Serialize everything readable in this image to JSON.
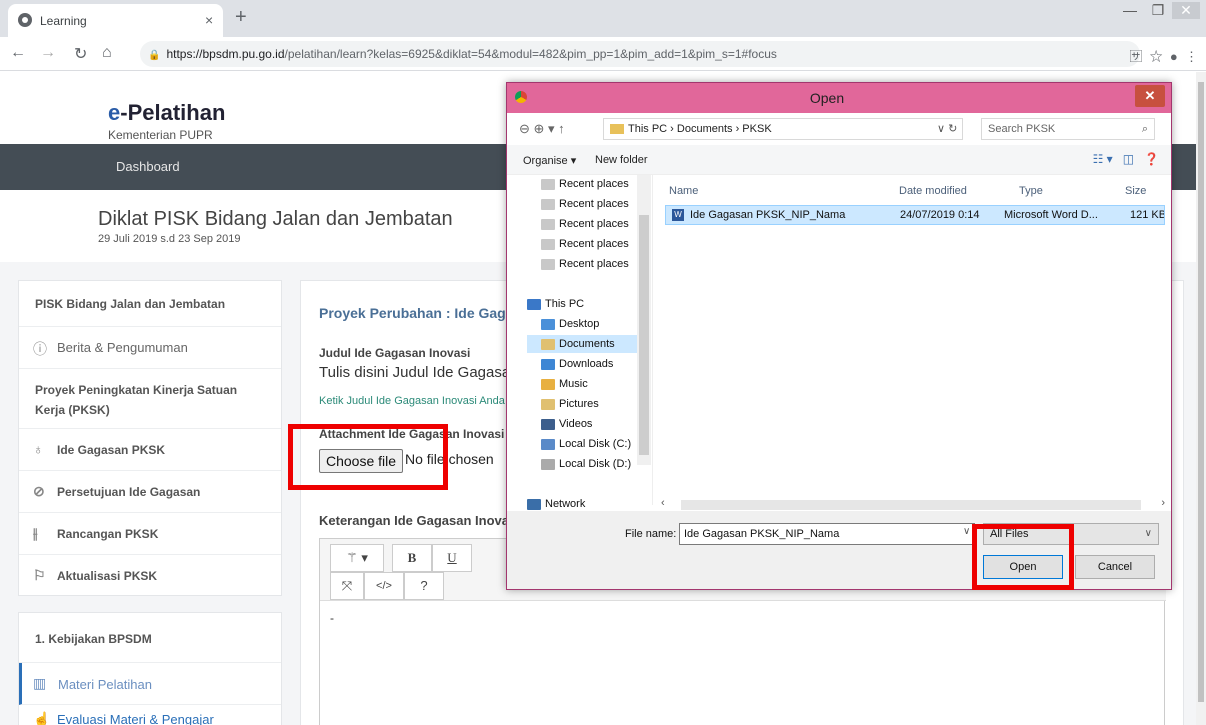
{
  "browser": {
    "tab_title": "Learning",
    "tab_close": "×",
    "new_tab": "+",
    "url_domain": "https://bpsdm.pu.go.id",
    "url_path": "/pelatihan/learn?kelas=6925&diklat=54&modul=482&pim_pp=1&pim_add=1&pim_s=1#focus"
  },
  "site": {
    "logo_e": "e",
    "logo_name": "-Pelatihan",
    "logo_sub": "Kementerian PUPR",
    "nav_dashboard": "Dashboard",
    "course_title": "Diklat PISK Bidang Jalan dan Jembatan",
    "course_dates": "29 Juli 2019 s.d 23 Sep 2019"
  },
  "sidebar": {
    "items": [
      {
        "label": "PISK Bidang Jalan dan Jembatan"
      },
      {
        "label": "Berita & Pengumuman",
        "icon": "ⓘ"
      },
      {
        "label": "Proyek Peningkatan Kinerja Satuan"
      },
      {
        "label": "Kerja (PKSK)"
      },
      {
        "label": "Ide Gagasan PKSK",
        "icon": "💡"
      },
      {
        "label": "Persetujuan Ide Gagasan",
        "icon": "⊘"
      },
      {
        "label": "Rancangan PKSK",
        "icon": "⫲"
      },
      {
        "label": "Aktualisasi PKSK",
        "icon": "⚲"
      }
    ],
    "section2_title": "1. Kebijakan BPSDM",
    "materi": "Materi Pelatihan",
    "evaluasi": "Evaluasi Materi & Pengajar"
  },
  "main": {
    "title": "Proyek Perubahan : Ide Gagasan PKSK",
    "judul_label": "Judul Ide Gagasan Inovasi",
    "judul_value": "Tulis disini Judul Ide Gagasan Inovasi",
    "judul_help": "Ketik Judul Ide Gagasan Inovasi Anda disini",
    "attach_label": "Attachment Ide Gagasan Inovasi",
    "choose_file": "Choose file",
    "no_file": "No file chosen",
    "ket_label": "Keterangan Ide Gagasan Inovasi",
    "editor_text": "-"
  },
  "dialog": {
    "title": "Open",
    "close": "✕",
    "breadcrumb": "This PC  ›  Documents  ›  PKSK",
    "search_placeholder": "Search PKSK",
    "organise": "Organise ▾",
    "new_folder": "New folder",
    "tree": [
      "Recent places",
      "Recent places",
      "Recent places",
      "Recent places",
      "Recent places",
      "This PC",
      "Desktop",
      "Documents",
      "Downloads",
      "Music",
      "Pictures",
      "Videos",
      "Local Disk (C:)",
      "Local Disk (D:)",
      "Network"
    ],
    "columns": {
      "name": "Name",
      "date": "Date modified",
      "type": "Type",
      "size": "Size"
    },
    "file": {
      "name": "Ide Gagasan PKSK_NIP_Nama",
      "date": "24/07/2019 0:14",
      "type": "Microsoft Word D...",
      "size": "121 KB"
    },
    "filename_label": "File name:",
    "filename_value": "Ide Gagasan PKSK_NIP_Nama",
    "filetype": "All Files",
    "open_btn": "Open",
    "cancel_btn": "Cancel"
  },
  "colors": {
    "highlight_box": "#ee0000",
    "dialog_title": "#e1679a",
    "navbar": "#444d55"
  }
}
